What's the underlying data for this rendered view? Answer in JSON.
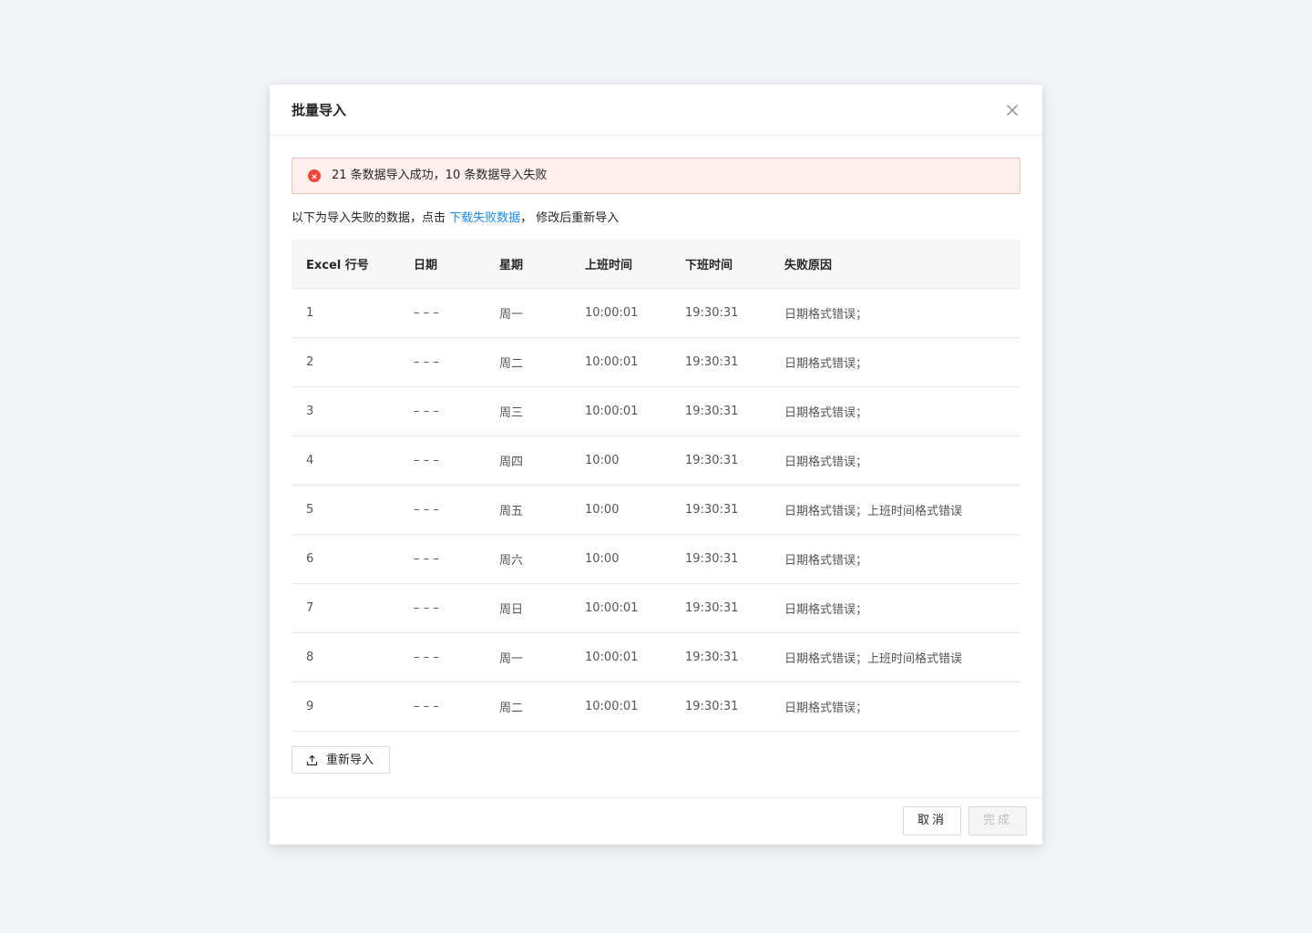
{
  "modal": {
    "title": "批量导入"
  },
  "alert": {
    "text": "21 条数据导入成功，10 条数据导入失败",
    "color": "#f5453a"
  },
  "hint": {
    "prefix": "以下为导入失败的数据，点击 ",
    "link": "下载失败数据",
    "suffix": "， 修改后重新导入",
    "link_color": "#1a8cf0"
  },
  "table": {
    "columns": [
      "Excel 行号",
      "日期",
      "星期",
      "上班时间",
      "下班时间",
      "失败原因"
    ],
    "rows": [
      [
        "1",
        "– – –",
        "周一",
        "10:00:01",
        "19:30:31",
        "日期格式错误；"
      ],
      [
        "2",
        "– – –",
        "周二",
        "10:00:01",
        "19:30:31",
        "日期格式错误；"
      ],
      [
        "3",
        "– – –",
        "周三",
        "10:00:01",
        "19:30:31",
        "日期格式错误；"
      ],
      [
        "4",
        "– – –",
        "周四",
        "10:00",
        "19:30:31",
        "日期格式错误；"
      ],
      [
        "5",
        "– – –",
        "周五",
        "10:00",
        "19:30:31",
        "日期格式错误；上班时间格式错误"
      ],
      [
        "6",
        "– – –",
        "周六",
        "10:00",
        "19:30:31",
        "日期格式错误；"
      ],
      [
        "7",
        "– – –",
        "周日",
        "10:00:01",
        "19:30:31",
        "日期格式错误；"
      ],
      [
        "8",
        "– – –",
        "周一",
        "10:00:01",
        "19:30:31",
        "日期格式错误；上班时间格式错误"
      ],
      [
        "9",
        "– – –",
        "周二",
        "10:00:01",
        "19:30:31",
        "日期格式错误；"
      ]
    ]
  },
  "reimport": {
    "label": "重新导入",
    "icon": "upload-icon"
  },
  "footer": {
    "cancel_label": "取消",
    "done_label": "完成"
  }
}
